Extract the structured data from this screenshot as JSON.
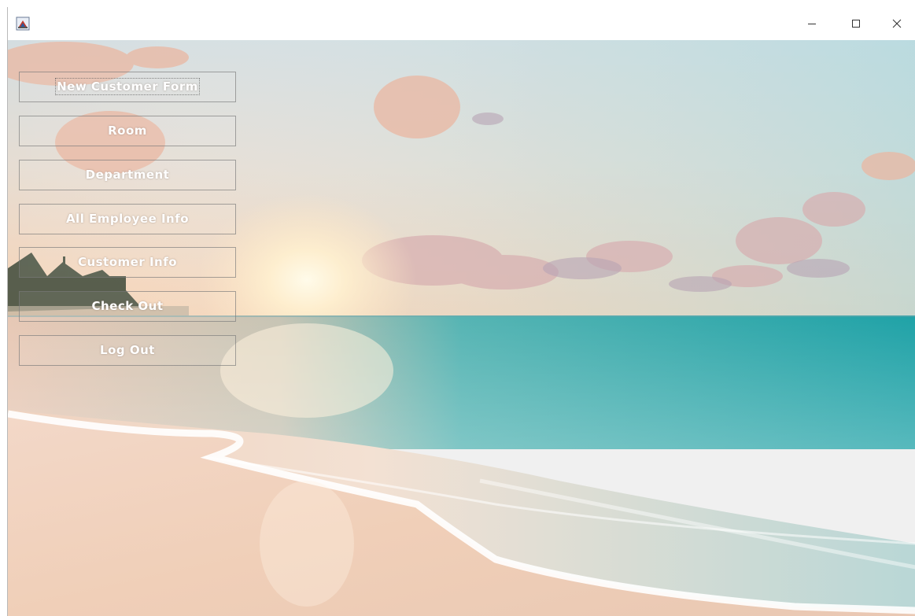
{
  "window": {
    "title": "",
    "controls": {
      "minimize_icon": "minimize-icon",
      "maximize_icon": "maximize-icon",
      "close_icon": "close-icon"
    }
  },
  "background": {
    "description_icon": "beach-sunset-background"
  },
  "menu": {
    "items": [
      {
        "label": "New Customer Form"
      },
      {
        "label": "Room"
      },
      {
        "label": "Department"
      },
      {
        "label": "All Employee Info"
      },
      {
        "label": "Customer Info"
      },
      {
        "label": "Check Out"
      },
      {
        "label": "Log Out"
      }
    ]
  },
  "colors": {
    "sky_top": "#d9dfe0",
    "sea": "#2aa7a8",
    "sand": "#f1d6c4",
    "button_text": "#ffffff"
  }
}
